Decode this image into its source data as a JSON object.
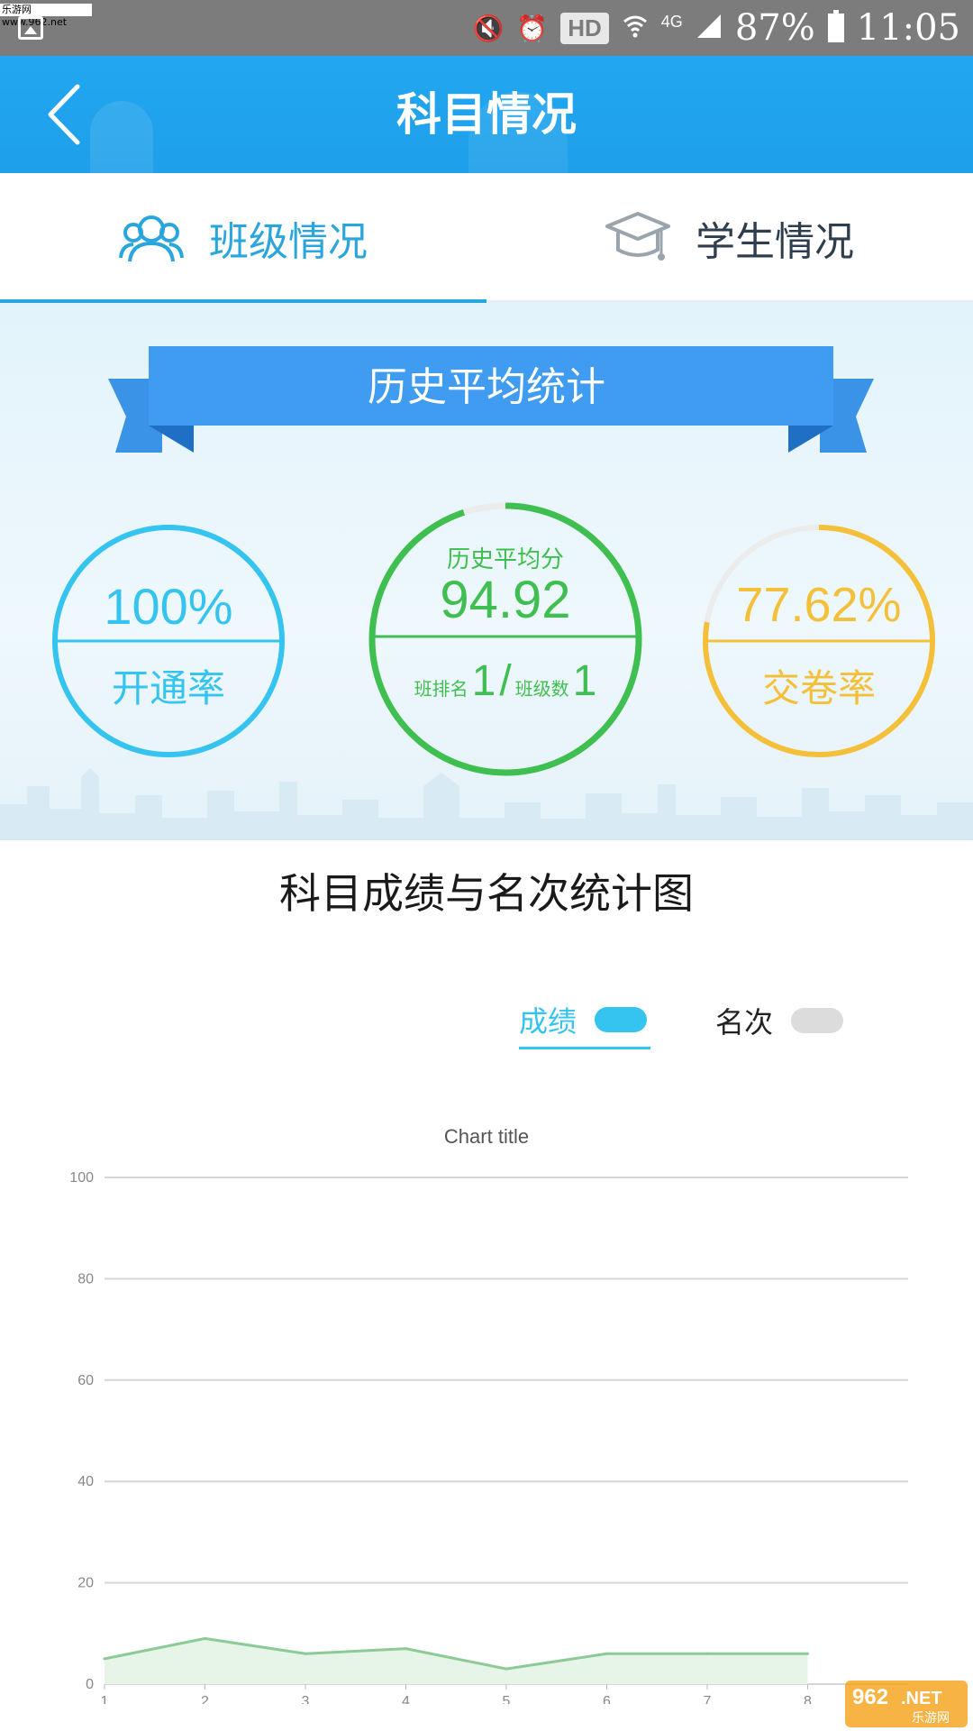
{
  "status_bar": {
    "watermark": "乐游网 www.962.net",
    "battery": "87%",
    "time": "11:05",
    "hd_label": "HD",
    "network_label": "4G"
  },
  "header": {
    "title": "科目情况",
    "back_icon": "chevron-left-icon"
  },
  "tabs": [
    {
      "label": "班级情况",
      "icon": "group-icon",
      "active": true
    },
    {
      "label": "学生情况",
      "icon": "graduation-cap-icon",
      "active": false
    }
  ],
  "stats": {
    "banner_title": "历史平均统计",
    "open_rate": {
      "value": "100%",
      "label": "开通率",
      "fraction": 1.0,
      "color": "#35c4ef"
    },
    "average": {
      "label": "历史平均分",
      "value": "94.92",
      "fraction": 0.9492,
      "rank_label": "班排名",
      "rank_value": "1",
      "separator": "/",
      "class_count_label": "班级数",
      "class_count_value": "1",
      "color": "#3fbf4f"
    },
    "submit_rate": {
      "value": "77.62%",
      "label": "交卷率",
      "fraction": 0.7762,
      "color": "#f4c03a"
    }
  },
  "chart_section": {
    "title": "科目成绩与名次统计图",
    "legend": [
      {
        "label": "成绩",
        "color": "#35c4ef",
        "active": true
      },
      {
        "label": "名次",
        "color": "#dcdcdc",
        "active": false
      }
    ]
  },
  "chart_data": {
    "type": "area",
    "title": "Chart title",
    "x": [
      1,
      2,
      3,
      4,
      5,
      6,
      7,
      8
    ],
    "series": [
      {
        "name": "成绩",
        "values": [
          5,
          9,
          6,
          7,
          3,
          6,
          6,
          6
        ]
      }
    ],
    "ylim": [
      0,
      100
    ],
    "yticks": [
      0,
      20,
      40,
      60,
      80,
      100
    ],
    "grid": true,
    "line_color": "#8cca96",
    "fill_color": "#e6f5e8"
  },
  "watermark_logo": {
    "top": "962",
    "suffix": ".NET",
    "sub": "乐游网"
  }
}
